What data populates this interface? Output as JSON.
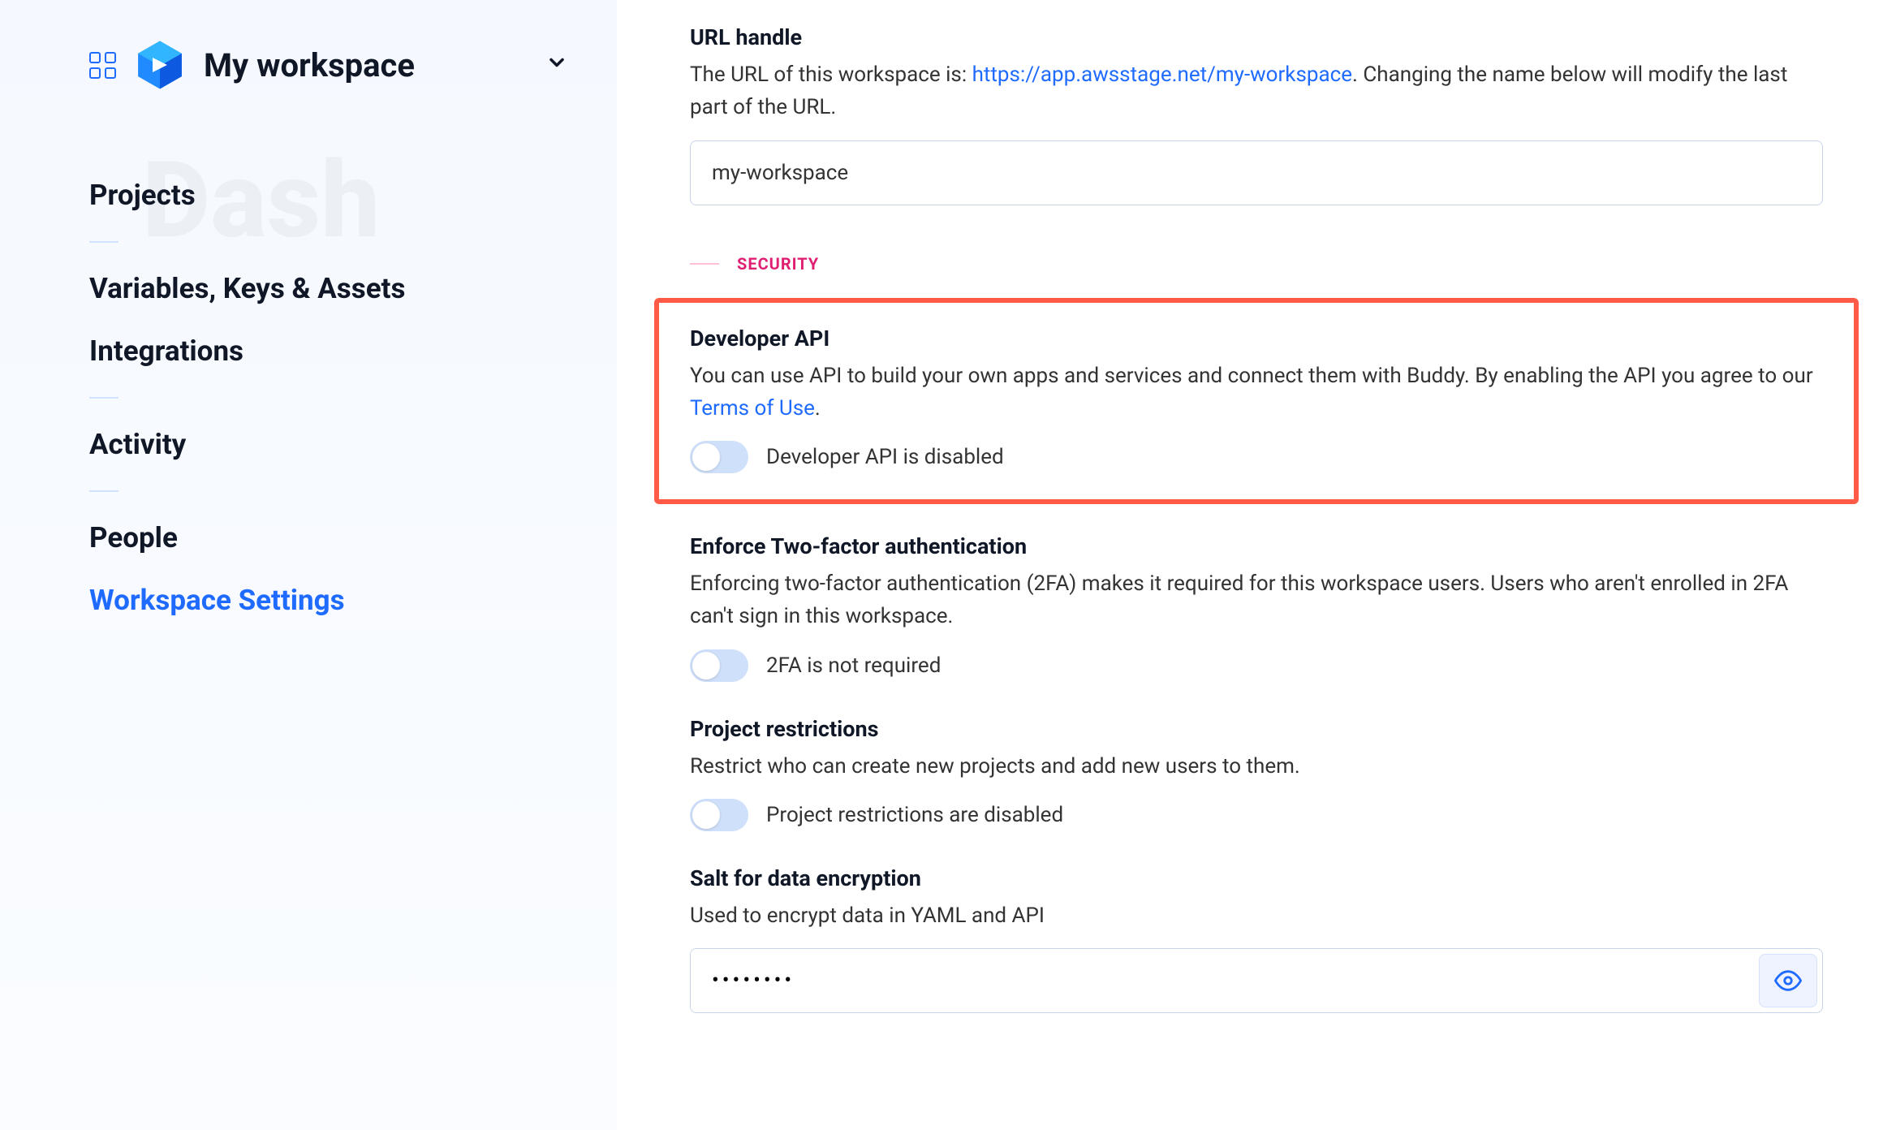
{
  "sidebar": {
    "workspace_name": "My workspace",
    "ghost_text": "Dash",
    "nav": {
      "projects": "Projects",
      "variables": "Variables, Keys & Assets",
      "integrations": "Integrations",
      "activity": "Activity",
      "people": "People",
      "workspace_settings": "Workspace Settings"
    }
  },
  "main": {
    "url_handle": {
      "label": "URL handle",
      "desc_pre": "The URL of this workspace is: ",
      "url": "https://app.awsstage.net/my-workspace",
      "desc_post": ". Changing the name below will modify the last part of the URL.",
      "value": "my-workspace"
    },
    "security_heading": "SECURITY",
    "developer_api": {
      "label": "Developer API",
      "desc_pre": "You can use API to build your own apps and services and connect them with Buddy. By enabling the API you agree to our ",
      "link": "Terms of Use",
      "desc_post": ".",
      "toggle_label": "Developer API is disabled"
    },
    "enforce_2fa": {
      "label": "Enforce Two-factor authentication",
      "desc": "Enforcing two-factor authentication (2FA) makes it required for this workspace users. Users who aren't enrolled in 2FA can't sign in this workspace.",
      "toggle_label": "2FA is not required"
    },
    "project_restrictions": {
      "label": "Project restrictions",
      "desc": "Restrict who can create new projects and add new users to them.",
      "toggle_label": "Project restrictions are disabled"
    },
    "salt": {
      "label": "Salt for data encryption",
      "desc": "Used to encrypt data in YAML and API",
      "value": "••••••••"
    }
  }
}
